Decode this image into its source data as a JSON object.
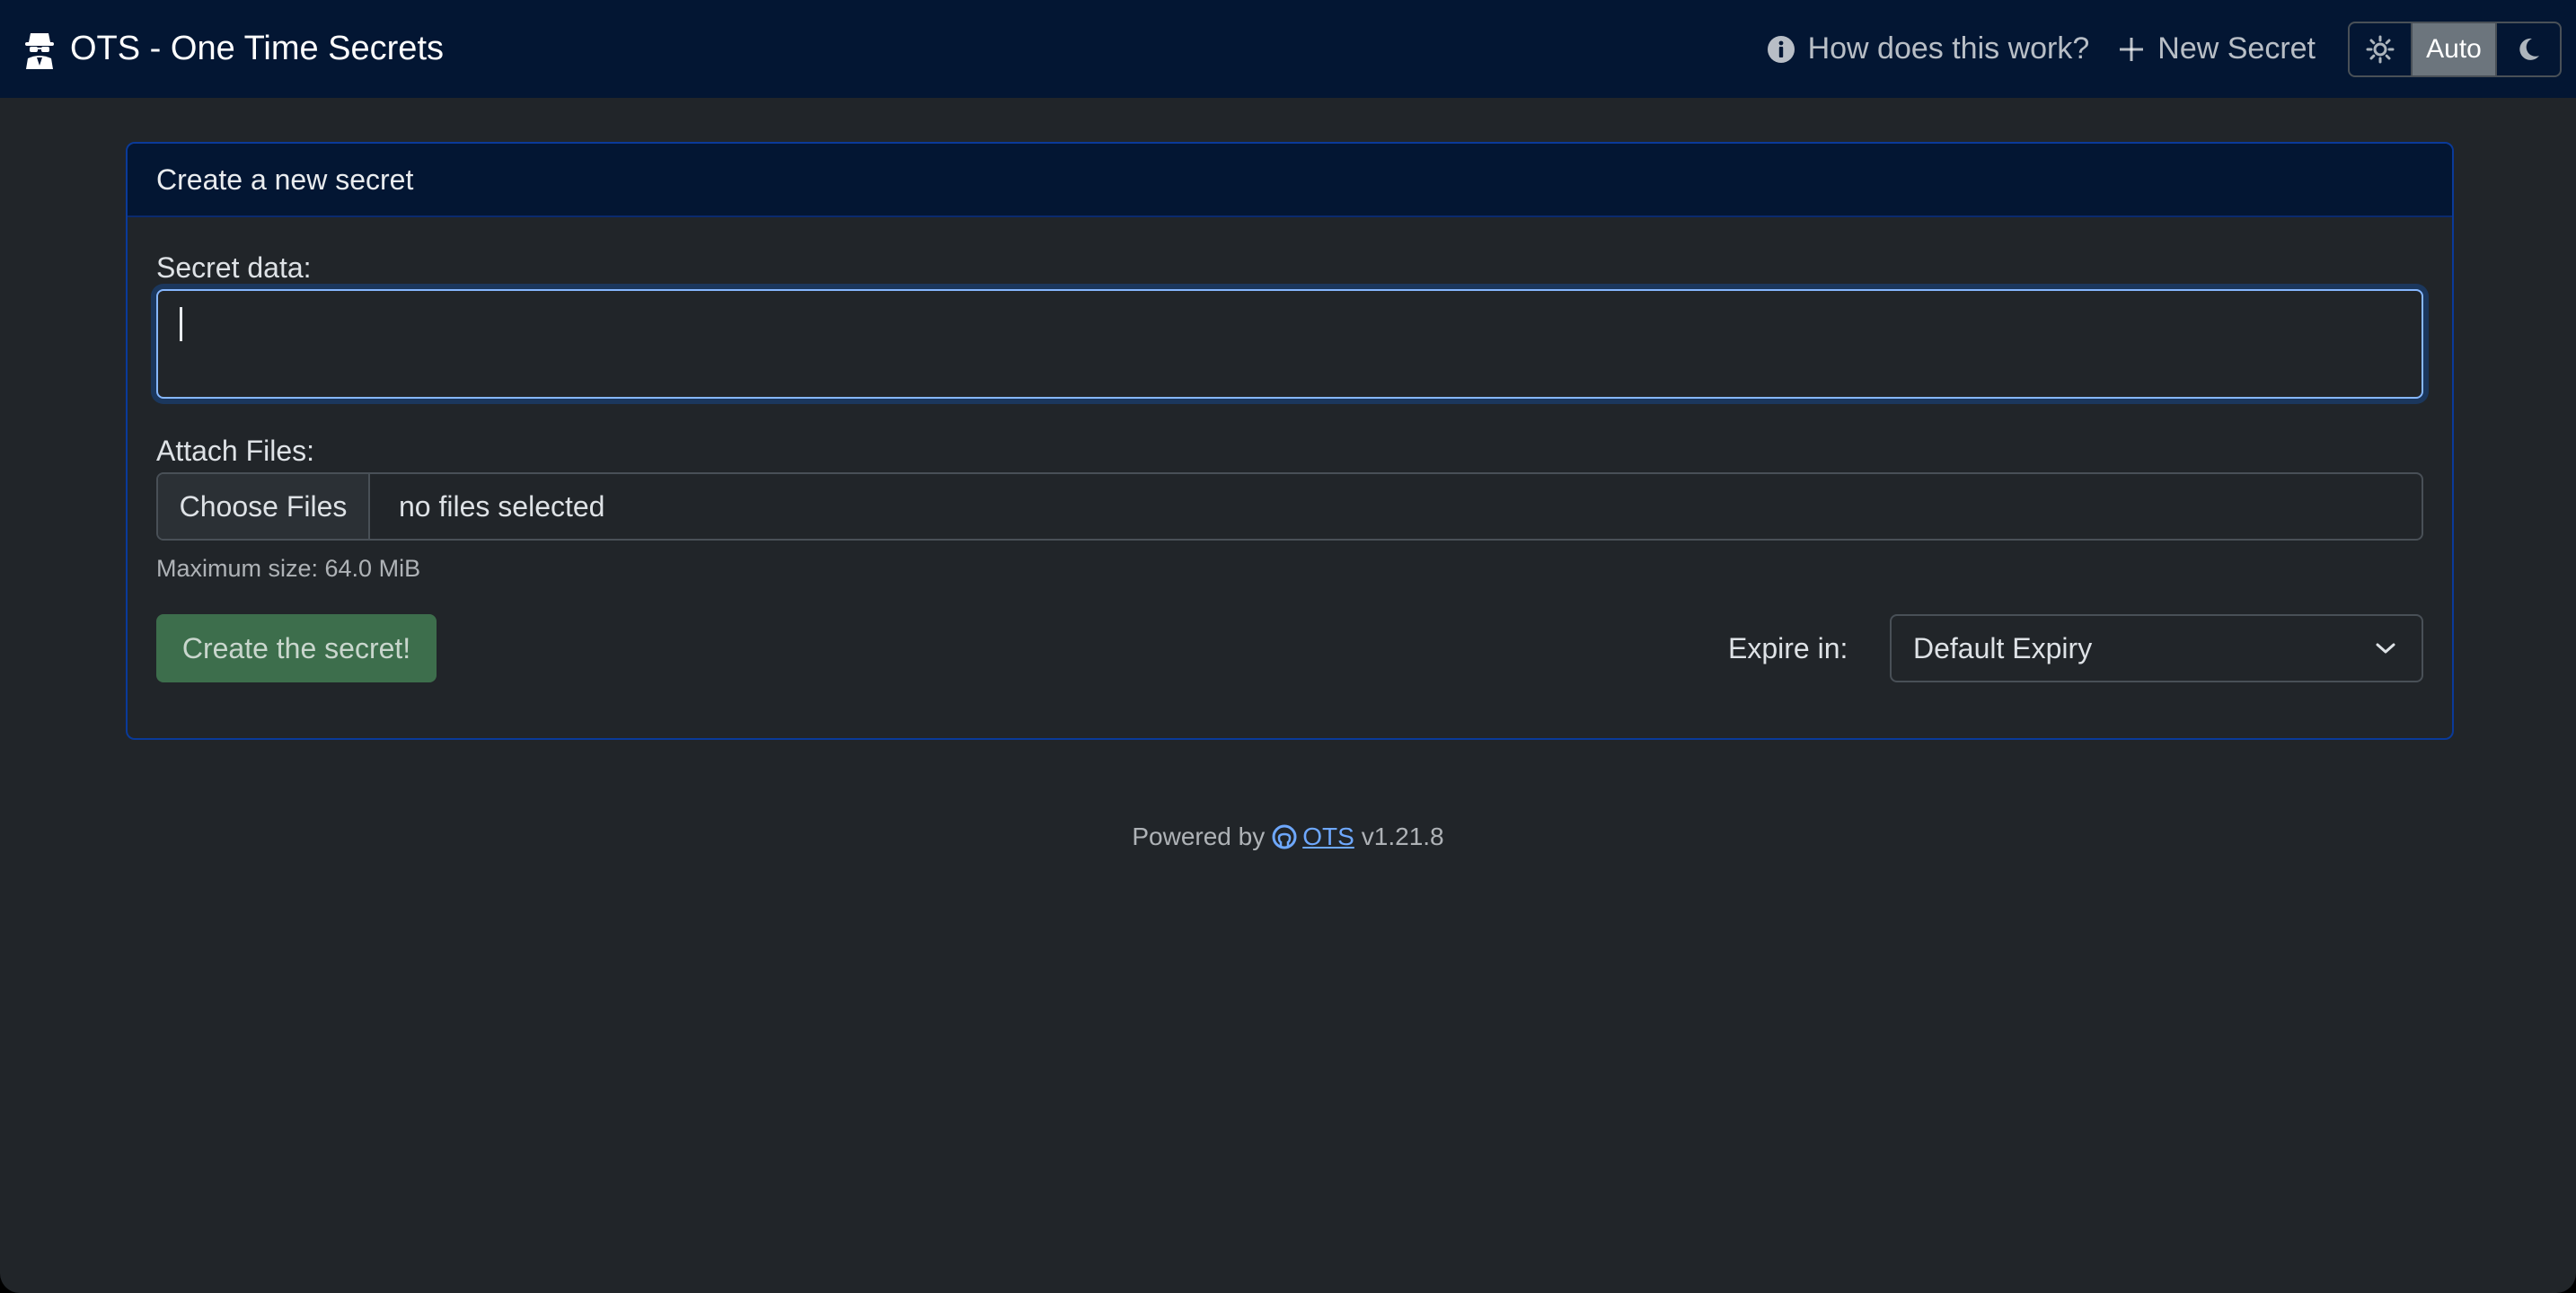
{
  "navbar": {
    "brand_title": "OTS - One Time Secrets",
    "how_label": "How does this work?",
    "new_secret_label": "New Secret",
    "theme": {
      "light_icon": "sun-icon",
      "auto_label": "Auto",
      "dark_icon": "moon-icon",
      "selected": "Auto"
    }
  },
  "card": {
    "header": "Create a new secret",
    "secret_label": "Secret data:",
    "secret_value": "",
    "attach_label": "Attach Files:",
    "choose_files_label": "Choose Files",
    "file_status": "no files selected",
    "max_size_text": "Maximum size: 64.0 MiB",
    "create_button": "Create the secret!",
    "expire_label": "Expire in:",
    "expire_selected": "Default Expiry"
  },
  "footer": {
    "powered_by": "Powered by",
    "link_text": " OTS",
    "version": "v1.21.8"
  },
  "colors": {
    "navbar_bg": "#031633",
    "page_bg": "#212529",
    "card_border": "#0a3a99",
    "create_button_bg": "#3d6e4c",
    "link": "#6ea8fe"
  }
}
